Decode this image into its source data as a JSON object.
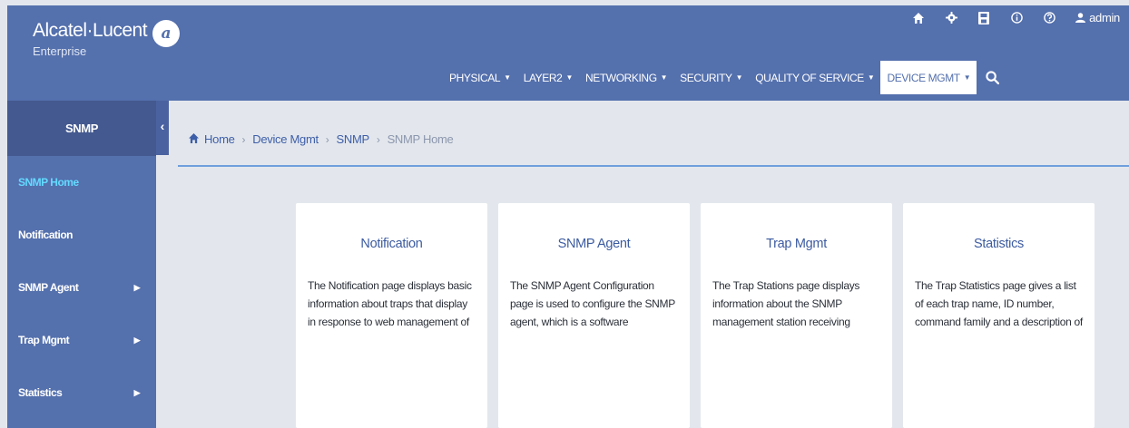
{
  "brand": {
    "name": "Alcatel·Lucent",
    "sub": "Enterprise",
    "mark": "𝒜"
  },
  "top_icons": {
    "home": "home-icon",
    "settings": "gear-icon",
    "save": "save-icon",
    "info": "info-icon",
    "help": "help-icon",
    "user": "user-icon"
  },
  "user": {
    "name": "admin"
  },
  "nav": {
    "items": [
      {
        "label": "PHYSICAL"
      },
      {
        "label": "LAYER2"
      },
      {
        "label": "NETWORKING"
      },
      {
        "label": "SECURITY"
      },
      {
        "label": "QUALITY OF SERVICE"
      },
      {
        "label": "DEVICE MGMT"
      }
    ],
    "active": "DEVICE MGMT"
  },
  "sidebar": {
    "title": "SNMP",
    "items": [
      {
        "label": "SNMP Home",
        "has_arrow": false
      },
      {
        "label": "Notification",
        "has_arrow": false
      },
      {
        "label": "SNMP Agent",
        "has_arrow": true
      },
      {
        "label": "Trap Mgmt",
        "has_arrow": true
      },
      {
        "label": "Statistics",
        "has_arrow": true
      }
    ],
    "active": "SNMP Home"
  },
  "breadcrumb": {
    "home": "Home",
    "level1": "Device Mgmt",
    "level2": "SNMP",
    "current": "SNMP Home",
    "separator": "›"
  },
  "cards": [
    {
      "title": "Notification",
      "desc": "The Notification page displays basic information about traps that display in response to web management of the..."
    },
    {
      "title": "SNMP Agent",
      "desc": "The SNMP Agent Configuration page is used to configure the SNMP agent, which is a software component that..."
    },
    {
      "title": "Trap Mgmt",
      "desc": "The Trap Stations page displays information about the SNMP management station receiving SNMP..."
    },
    {
      "title": "Statistics",
      "desc": "The Trap Statistics page gives a list of each trap name, ID number, command family and a description of the conditio..."
    }
  ],
  "colors": {
    "header": "#5470ad",
    "sidebar_title": "#44598f",
    "active_sidebar_text": "#63d9ff",
    "link": "#3d5ea8",
    "background": "#e3e7ed"
  }
}
